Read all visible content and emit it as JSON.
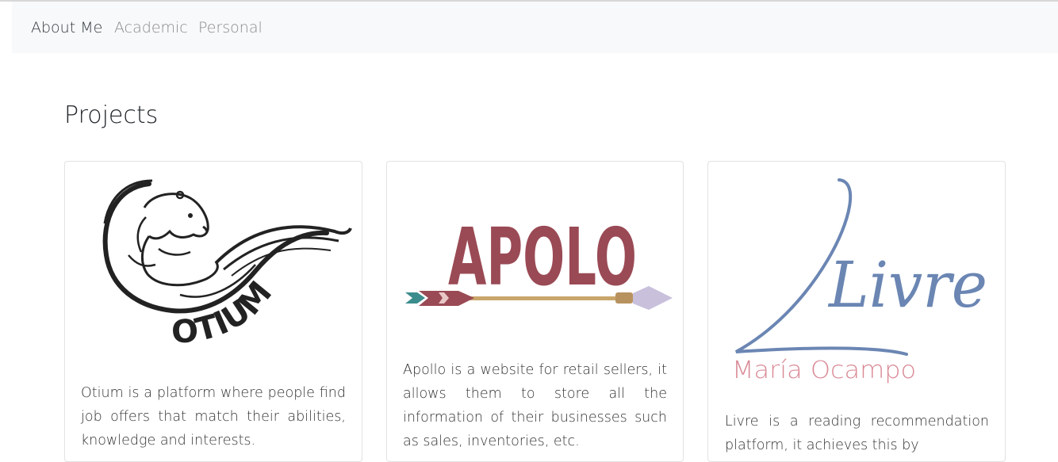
{
  "nav": {
    "items": [
      {
        "label": "About Me",
        "active": true
      },
      {
        "label": "Academic",
        "active": false
      },
      {
        "label": "Personal",
        "active": false
      }
    ]
  },
  "main": {
    "title": "Projects",
    "projects": [
      {
        "logo_icon": "otium-otter-logo",
        "logo_text": "OTIUM",
        "description": "Otium is a platform where people find job offers that match their abilities, knowledge and interests."
      },
      {
        "logo_icon": "apolo-arrow-logo",
        "logo_text": "APOLO",
        "description": "Apollo is a website for retail sellers, it allows them to store all the information of their businesses such as sales, inventories, etc."
      },
      {
        "logo_icon": "livre-script-logo",
        "logo_text": "Livre",
        "logo_subtitle": "María Ocampo",
        "description": "Livre is a reading recommendation platform, it achieves this by"
      }
    ]
  },
  "colors": {
    "apolo_text": "#9a4a55",
    "livre_blue": "#6b86b3",
    "livre_pink": "#d98a96",
    "arrow_shaft": "#c9a66b",
    "arrow_teal": "#3b8c8c",
    "arrow_tip": "#c9c0dc"
  }
}
